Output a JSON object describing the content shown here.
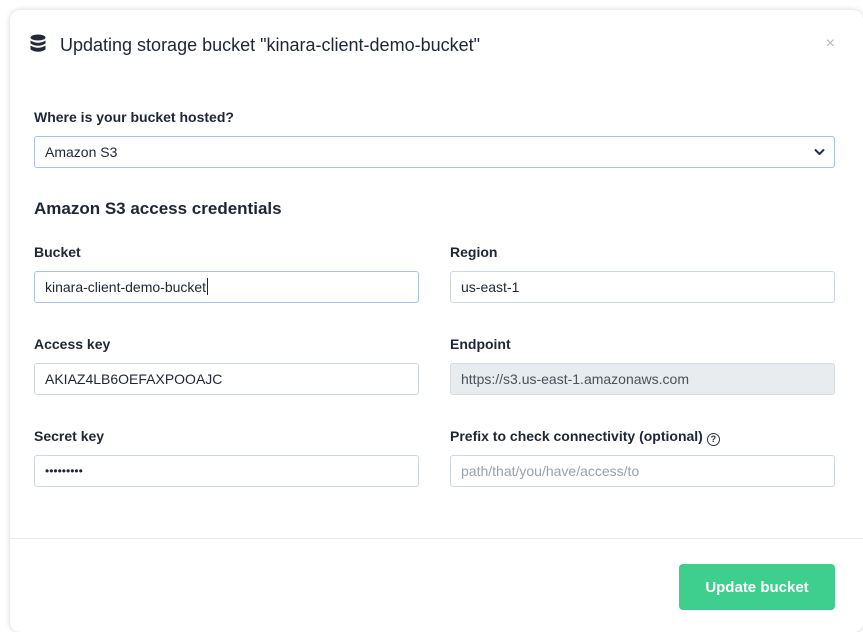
{
  "modal": {
    "title": "Updating storage bucket \"kinara-client-demo-bucket\"",
    "close_glyph": "×",
    "icon": "database-icon"
  },
  "hosting": {
    "label": "Where is your bucket hosted?",
    "selected": "Amazon S3"
  },
  "credentials": {
    "section_title": "Amazon S3 access credentials",
    "bucket": {
      "label": "Bucket",
      "value": "kinara-client-demo-bucket"
    },
    "region": {
      "label": "Region",
      "value": "us-east-1"
    },
    "access_key": {
      "label": "Access key",
      "value": "AKIAZ4LB6OEFAXPOOAJC"
    },
    "endpoint": {
      "label": "Endpoint",
      "value": "https://s3.us-east-1.amazonaws.com"
    },
    "secret_key": {
      "label": "Secret key",
      "value": "•••••••••"
    },
    "prefix": {
      "label": "Prefix to check connectivity (optional)",
      "placeholder": "path/that/you/have/access/to",
      "help_icon": "question-circle-icon"
    }
  },
  "footer": {
    "submit_label": "Update bucket"
  },
  "colors": {
    "primary": "#3ecf8e",
    "text": "#1f2533",
    "border": "#cfd5dd",
    "readonly_bg": "#e9ecef"
  }
}
